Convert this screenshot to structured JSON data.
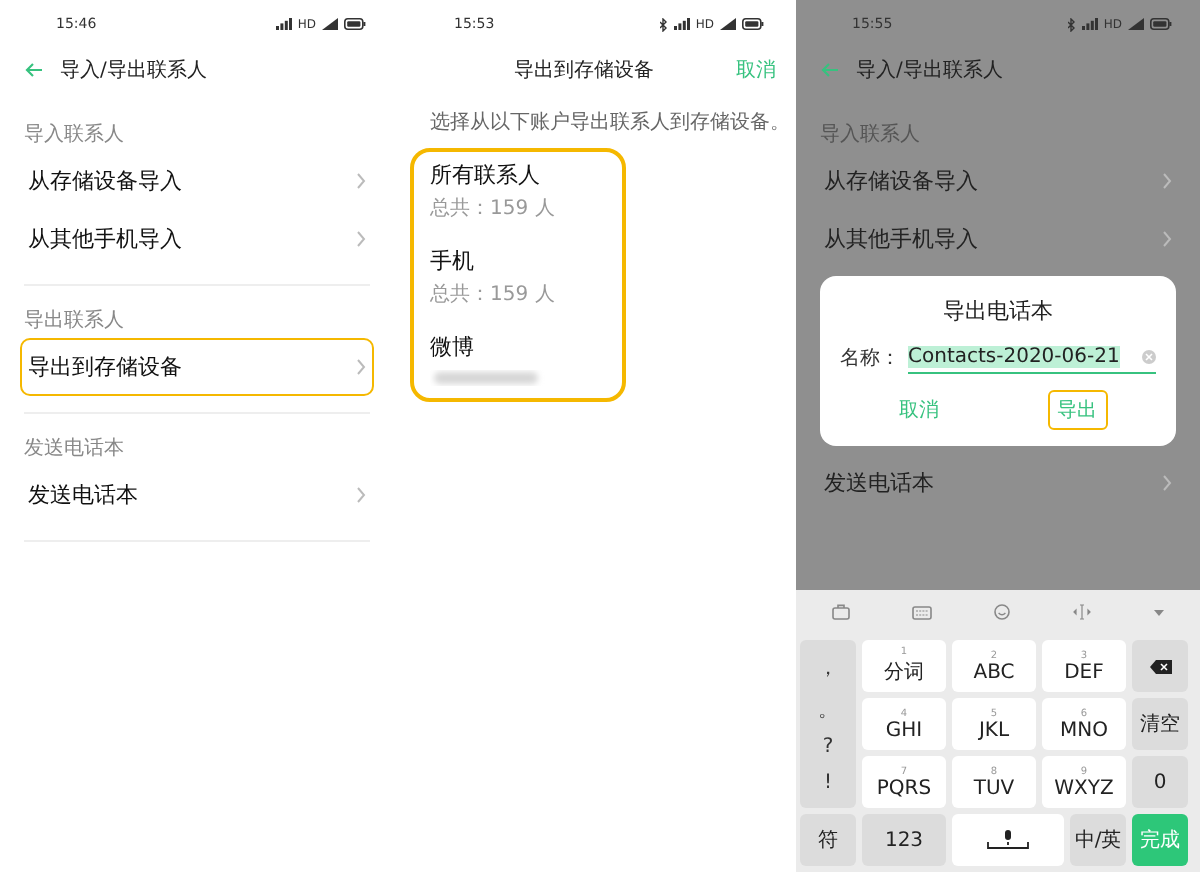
{
  "import_export_screen": {
    "status": {
      "time": "15:46",
      "hd": "HD"
    },
    "title": "导入/导出联系人",
    "sections": [
      {
        "heading": "导入联系人",
        "items": [
          {
            "label": "从存储设备导入",
            "highlighted": false
          },
          {
            "label": "从其他手机导入",
            "highlighted": false
          }
        ]
      },
      {
        "heading": "导出联系人",
        "items": [
          {
            "label": "导出到存储设备",
            "highlighted": true
          }
        ]
      },
      {
        "heading": "发送电话本",
        "items": [
          {
            "label": "发送电话本",
            "highlighted": false
          }
        ]
      }
    ]
  },
  "export_storage_screen": {
    "status": {
      "time": "15:53",
      "hd": "HD",
      "bluetooth": true
    },
    "title": "导出到存储设备",
    "cancel": "取消",
    "hint": "选择从以下账户导出联系人到存储设备。",
    "accounts_highlighted": true,
    "accounts": [
      {
        "name": "所有联系人",
        "count": "总共：159 人",
        "blurred": false
      },
      {
        "name": "手机",
        "count": "总共：159 人",
        "blurred": false
      },
      {
        "name": "微博",
        "blurred": true
      }
    ]
  },
  "export_dialog_screen": {
    "status": {
      "time": "15:55",
      "hd": "HD",
      "bluetooth": true
    },
    "title": "导入/导出联系人",
    "section_heading": "导入联系人",
    "items_above": [
      {
        "label": "从存储设备导入"
      },
      {
        "label": "从其他手机导入"
      }
    ],
    "items_below": [
      {
        "label": "发送电话本"
      }
    ],
    "dialog": {
      "title": "导出电话本",
      "name_label": "名称：",
      "value": "Contacts-2020-06-21",
      "buttons": [
        {
          "label": "取消",
          "highlighted": false
        },
        {
          "label": "导出",
          "highlighted": true
        }
      ]
    },
    "keyboard": {
      "symbols": [
        "，",
        "。",
        "?",
        "!"
      ],
      "keys": [
        {
          "hint": "1",
          "label": "分词"
        },
        {
          "hint": "2",
          "label": "ABC"
        },
        {
          "hint": "3",
          "label": "DEF"
        },
        {
          "hint": "4",
          "label": "GHI"
        },
        {
          "hint": "5",
          "label": "JKL"
        },
        {
          "hint": "6",
          "label": "MNO"
        },
        {
          "hint": "7",
          "label": "PQRS"
        },
        {
          "hint": "8",
          "label": "TUV"
        },
        {
          "hint": "9",
          "label": "WXYZ"
        }
      ],
      "clear": "清空",
      "zero": "0",
      "symbol_key": "符",
      "number_key": "123",
      "language_key": "中/英",
      "done": "完成"
    }
  }
}
